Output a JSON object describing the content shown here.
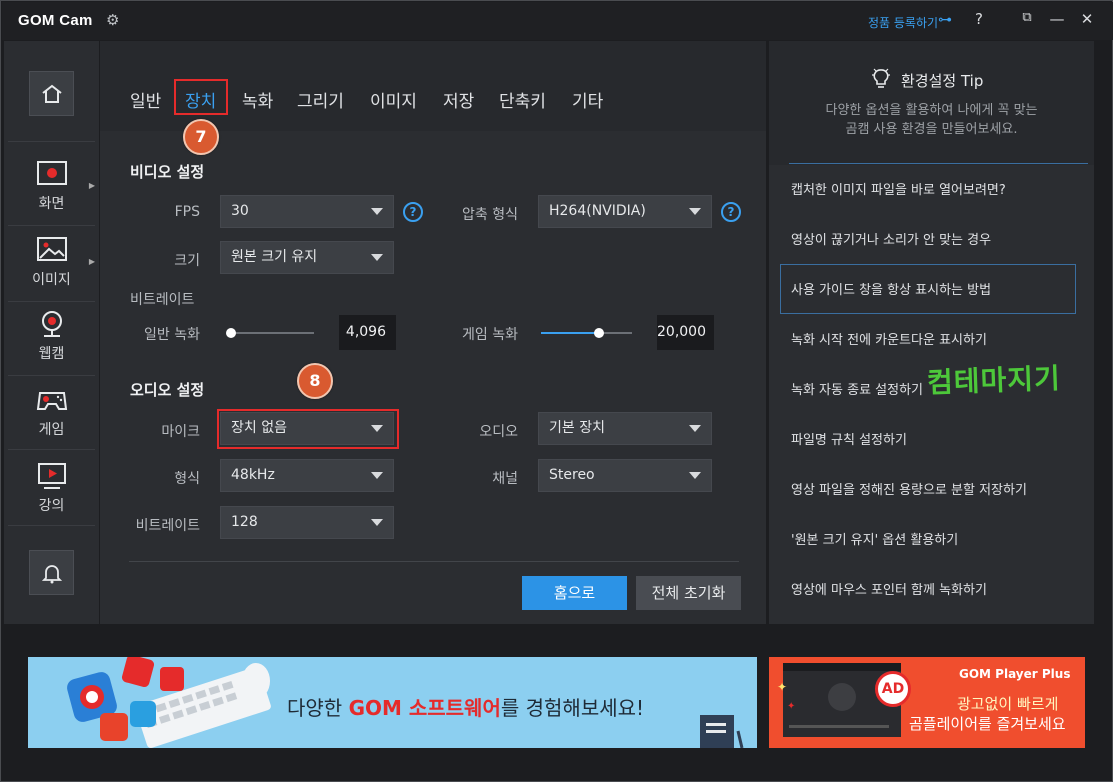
{
  "window": {
    "title": "GOM Cam",
    "register_label": "정품 등록하기",
    "help_label": "?",
    "restore_label": "⧉",
    "minimize_label": "—",
    "close_label": "✕"
  },
  "sidebar": {
    "items": [
      {
        "label": "화면",
        "icon": "screen-record-icon"
      },
      {
        "label": "이미지",
        "icon": "image-icon"
      },
      {
        "label": "웹캠",
        "icon": "webcam-icon"
      },
      {
        "label": "게임",
        "icon": "gamepad-icon"
      },
      {
        "label": "강의",
        "icon": "lecture-icon"
      }
    ]
  },
  "tabs": [
    "일반",
    "장치",
    "녹화",
    "그리기",
    "이미지",
    "저장",
    "단축키",
    "기타"
  ],
  "active_tab": "장치",
  "annotations": {
    "badge7": "7",
    "badge8": "8"
  },
  "video": {
    "title": "비디오 설정",
    "fps_label": "FPS",
    "fps_value": "30",
    "codec_label": "압축 형식",
    "codec_value": "H264(NVIDIA)",
    "size_label": "크기",
    "size_value": "원본 크기 유지",
    "bitrate_label": "비트레이트",
    "normal_label": "일반 녹화",
    "normal_value": "4,096",
    "normal_level": 0.04,
    "game_label": "게임 녹화",
    "game_value": "20,000",
    "game_level": 0.64
  },
  "audio": {
    "title": "오디오 설정",
    "mic_label": "마이크",
    "mic_value": "장치 없음",
    "audio_label": "오디오",
    "audio_value": "기본 장치",
    "format_label": "형식",
    "format_value": "48kHz",
    "channel_label": "채널",
    "channel_value": "Stereo",
    "bitrate_label": "비트레이트",
    "bitrate_value": "128"
  },
  "buttons": {
    "home": "홈으로",
    "reset": "전체 초기화"
  },
  "tip": {
    "title": "환경설정 Tip",
    "desc_line1": "다양한 옵션을 활용하여 나에게 꼭 맞는",
    "desc_line2": "곰캠 사용 환경을 만들어보세요.",
    "items": [
      "캡처한 이미지 파일을 바로 열어보려면?",
      "영상이 끊기거나 소리가 안 맞는 경우",
      "사용 가이드 창을 항상 표시하는 방법",
      "녹화 시작 전에 카운트다운 표시하기",
      "녹화 자동 종료 설정하기",
      "파일명 규칙 설정하기",
      "영상 파일을 정해진 용량으로 분할 저장하기",
      "'원본 크기 유지' 옵션 활용하기",
      "영상에 마우스 포인터 함께 녹화하기"
    ],
    "watermark": "컴테마지기"
  },
  "banners": {
    "left_prefix": "다양한 ",
    "left_highlight": "GOM 소프트웨어",
    "left_suffix": "를 경험해보세요!",
    "right_brand": "GOM Player Plus",
    "right_line1": "광고없이 빠르게",
    "right_line2": "곰플레이어를 즐겨보세요",
    "right_badge": "AD"
  }
}
